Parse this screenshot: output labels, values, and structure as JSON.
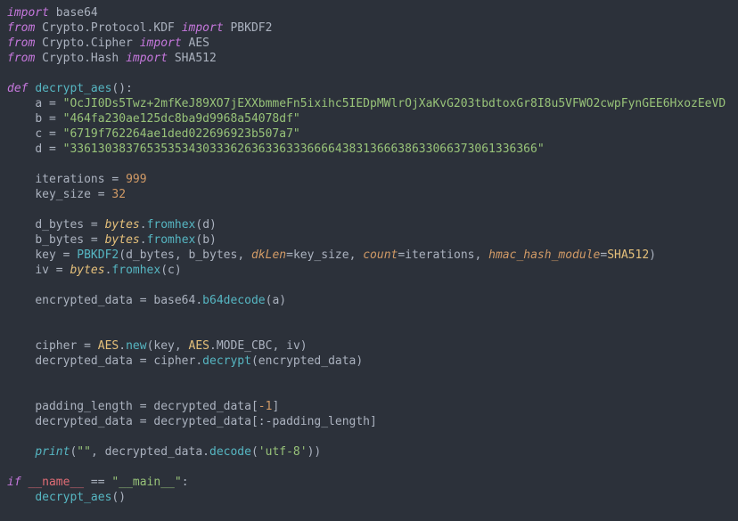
{
  "imports": {
    "l1_a": "import",
    "l1_b": "base64",
    "l2_a": "from",
    "l2_b": "Crypto.Protocol.KDF",
    "l2_c": "import",
    "l2_d": "PBKDF2",
    "l3_a": "from",
    "l3_b": "Crypto.Cipher",
    "l3_c": "import",
    "l3_d": "AES",
    "l4_a": "from",
    "l4_b": "Crypto.Hash",
    "l4_c": "import",
    "l4_d": "SHA512"
  },
  "defs": {
    "kw_def": "def",
    "fn_name": "decrypt_aes",
    "call_main": "decrypt_aes"
  },
  "strings": {
    "a": "\"OcJI0Ds5Twz+2mfKeJ89XO7jEXXbmmeFn5ixihc5IEDpMWlrOjXaKvG203tbdtoxGr8I8u5VFWO2cwpFynGEE6HxozEeVD",
    "b": "\"464fa230ae125dc8ba9d9968a54078df\"",
    "c": "\"6719f762264ae1ded022696923b507a7\"",
    "d": "\"3361303837653535343033362636336333666643831366638633066373061336366\"",
    "empty": "\"\"",
    "utf8": "'utf-8'",
    "main": "\"__main__\""
  },
  "nums": {
    "iterations": "999",
    "key_size": "32",
    "neg1": "-1"
  },
  "idents": {
    "a": "a",
    "b": "b",
    "c": "c",
    "d": "d",
    "iterations": "iterations",
    "key_size": "key_size",
    "d_bytes": "d_bytes",
    "b_bytes": "b_bytes",
    "key": "key",
    "iv": "iv",
    "encrypted_data": "encrypted_data",
    "cipher": "cipher",
    "decrypted_data": "decrypted_data",
    "padding_length": "padding_length",
    "bytes": "bytes",
    "fromhex": "fromhex",
    "base64": "base64",
    "b64decode": "b64decode",
    "AES": "AES",
    "new": "new",
    "MODE_CBC": "MODE_CBC",
    "decrypt": "decrypt",
    "print": "print",
    "decode": "decode",
    "PBKDF2": "PBKDF2",
    "SHA512": "SHA512",
    "dkLen": "dkLen",
    "count": "count",
    "hmac_hash_module": "hmac_hash_module",
    "name_dunder": "__name__"
  },
  "kw": {
    "if": "if"
  }
}
